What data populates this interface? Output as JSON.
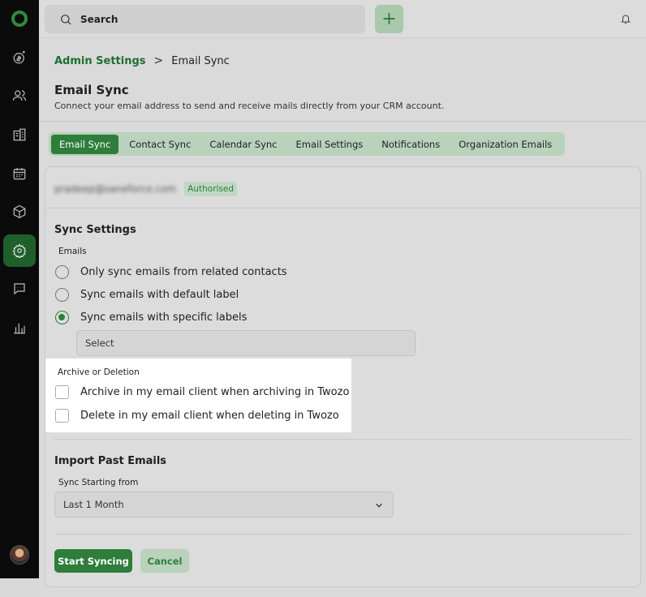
{
  "sidebar": {
    "items": [
      {
        "icon": "dollar-icon"
      },
      {
        "icon": "contacts-icon"
      },
      {
        "icon": "building-icon"
      },
      {
        "icon": "calendar-icon"
      },
      {
        "icon": "box-icon"
      },
      {
        "icon": "gear-icon"
      },
      {
        "icon": "chat-icon"
      },
      {
        "icon": "chart-icon"
      }
    ],
    "active_icon": "gear-icon"
  },
  "topbar": {
    "search_label": "Search",
    "add_label": "+"
  },
  "breadcrumb": {
    "parent": "Admin Settings",
    "separator": ">",
    "current": "Email Sync"
  },
  "page": {
    "title": "Email Sync",
    "subtitle": "Connect your email address to send and receive mails directly from your CRM account."
  },
  "tabs": [
    {
      "label": "Email Sync",
      "active": true
    },
    {
      "label": "Contact Sync",
      "active": false
    },
    {
      "label": "Calendar Sync",
      "active": false
    },
    {
      "label": "Email Settings",
      "active": false
    },
    {
      "label": "Notifications",
      "active": false
    },
    {
      "label": "Organization Emails",
      "active": false
    }
  ],
  "account": {
    "email": "pradeep@saneforce.com",
    "status": "Authorised"
  },
  "sync_settings": {
    "title": "Sync Settings",
    "emails_label": "Emails",
    "options": [
      {
        "label": "Only sync emails from related contacts",
        "checked": false
      },
      {
        "label": "Sync emails with default label",
        "checked": false
      },
      {
        "label": "Sync emails with specific labels",
        "checked": true
      }
    ],
    "select_placeholder": "Select"
  },
  "archive": {
    "label": "Archive or Deletion",
    "options": [
      {
        "label": "Archive in my email client when archiving in Twozo",
        "checked": false
      },
      {
        "label": "Delete in my email client when deleting in Twozo",
        "checked": false
      }
    ]
  },
  "import": {
    "title": "Import Past Emails",
    "field_label": "Sync Starting from",
    "value": "Last 1 Month"
  },
  "actions": {
    "primary": "Start Syncing",
    "secondary": "Cancel"
  },
  "colors": {
    "accent": "#2e7d3a",
    "accent_light": "#b8d2bb",
    "sidebar_bg": "#0b0b0b"
  }
}
